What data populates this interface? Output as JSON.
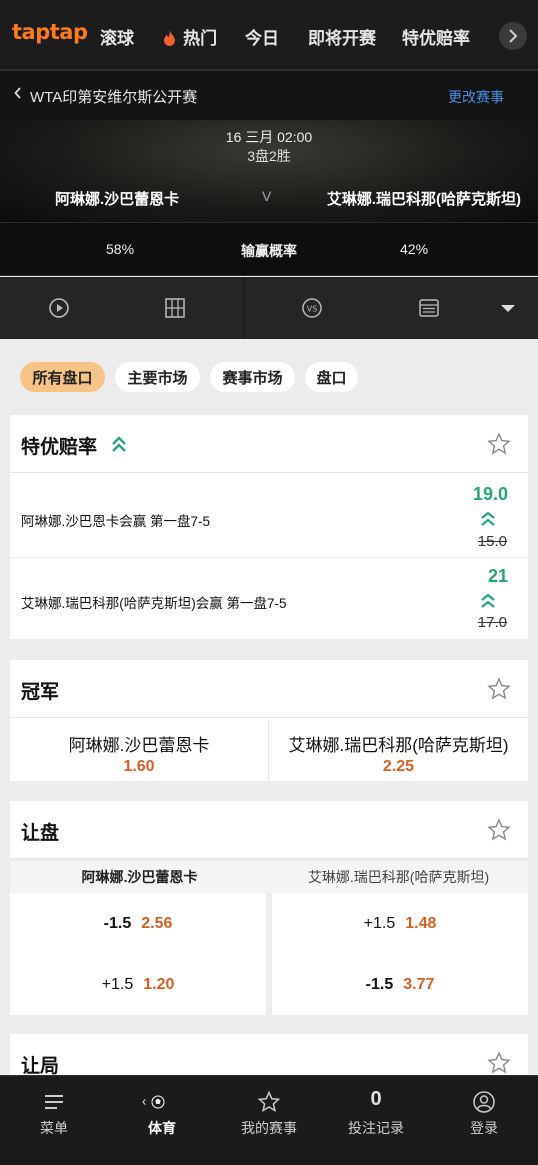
{
  "topnav": {
    "logo": "taptap",
    "items": [
      {
        "label": "滚球"
      },
      {
        "label": "热门",
        "icon": "flame-icon"
      },
      {
        "label": "今日"
      },
      {
        "label": "即将开赛"
      },
      {
        "label": "特优赔率"
      }
    ],
    "next_icon": "chevron-right-icon"
  },
  "event": {
    "back_icon": "chevron-left-icon",
    "title": "WTA印第安维尔斯公开赛",
    "change_label": "更改赛事"
  },
  "match": {
    "date": "16 三月 02:00",
    "format": "3盘2胜",
    "home": "阿琳娜.沙巴蕾恩卡",
    "vs": "V",
    "away": "艾琳娜.瑞巴科那(哈萨克斯坦)"
  },
  "probability": {
    "home": "58%",
    "label": "输赢概率",
    "away": "42%"
  },
  "media_icons": [
    "play-icon",
    "court-icon",
    "vs-icon",
    "scoreboard-icon",
    "dropdown-triangle-icon"
  ],
  "filters": [
    {
      "label": "所有盘口",
      "active": true
    },
    {
      "label": "主要市场",
      "active": false
    },
    {
      "label": "赛事市场",
      "active": false
    },
    {
      "label": "盘口",
      "active": false
    }
  ],
  "special_odds": {
    "title": "特优赔率",
    "icon": "boost-arrows-icon",
    "rows": [
      {
        "text": "阿琳娜.沙巴恩卡会赢 第一盘7-5",
        "new_odds": "19.0",
        "old_odds": "15.0"
      },
      {
        "text": "艾琳娜.瑞巴科那(哈萨克斯坦)会赢 第一盘7-5",
        "new_odds": "21",
        "old_odds": "17.0"
      }
    ]
  },
  "winner": {
    "title": "冠军",
    "options": [
      {
        "name": "阿琳娜.沙巴蕾恩卡",
        "odds": "1.60"
      },
      {
        "name": "艾琳娜.瑞巴科那(哈萨克斯坦)",
        "odds": "2.25"
      }
    ]
  },
  "handicap": {
    "title": "让盘",
    "home_header": "阿琳娜.沙巴蕾恩卡",
    "away_header": "艾琳娜.瑞巴科那(哈萨克斯坦)",
    "rows": [
      {
        "home_line": "-1.5",
        "home_odds": "2.56",
        "away_line": "+1.5",
        "away_odds": "1.48"
      },
      {
        "home_line": "+1.5",
        "home_odds": "1.20",
        "away_line": "-1.5",
        "away_odds": "3.77"
      }
    ]
  },
  "games_handicap": {
    "title": "让局"
  },
  "bottomnav": {
    "items": [
      {
        "label": "菜单",
        "icon": "menu-icon"
      },
      {
        "label": "体育",
        "icon": "soccer-ball-icon",
        "active": true
      },
      {
        "label": "我的赛事",
        "icon": "star-icon"
      },
      {
        "label": "投注记录",
        "count": "0"
      },
      {
        "label": "登录",
        "icon": "user-icon"
      }
    ]
  },
  "colors": {
    "accent_orange": "#ff7a1a",
    "odds_orange": "#d95f27",
    "boost_green": "#2aa37f",
    "link_blue": "#4a90e2",
    "chip_active": "#f7c487"
  }
}
